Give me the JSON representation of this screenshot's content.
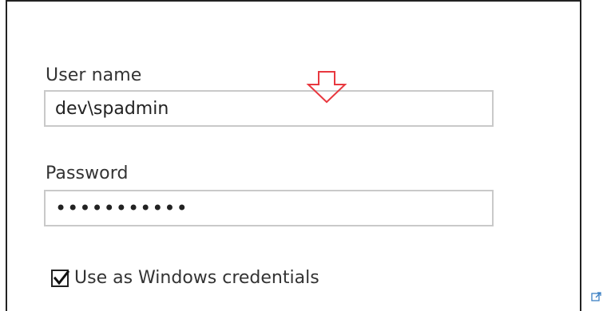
{
  "form": {
    "username_label": "User name",
    "username_value": "dev\\spadmin",
    "password_label": "Password",
    "password_value": "•••••••••••",
    "windows_credentials_label": "Use as Windows credentials",
    "windows_credentials_checked": true
  },
  "icons": {
    "annotation_arrow": "down-arrow-icon",
    "external_link": "external-link-icon",
    "checkmark": "checkmark-icon"
  },
  "colors": {
    "annotation_arrow": "#e8383f",
    "input_border": "#c9c9c9",
    "dialog_border": "#222222",
    "external_link": "#3b7fc4"
  }
}
